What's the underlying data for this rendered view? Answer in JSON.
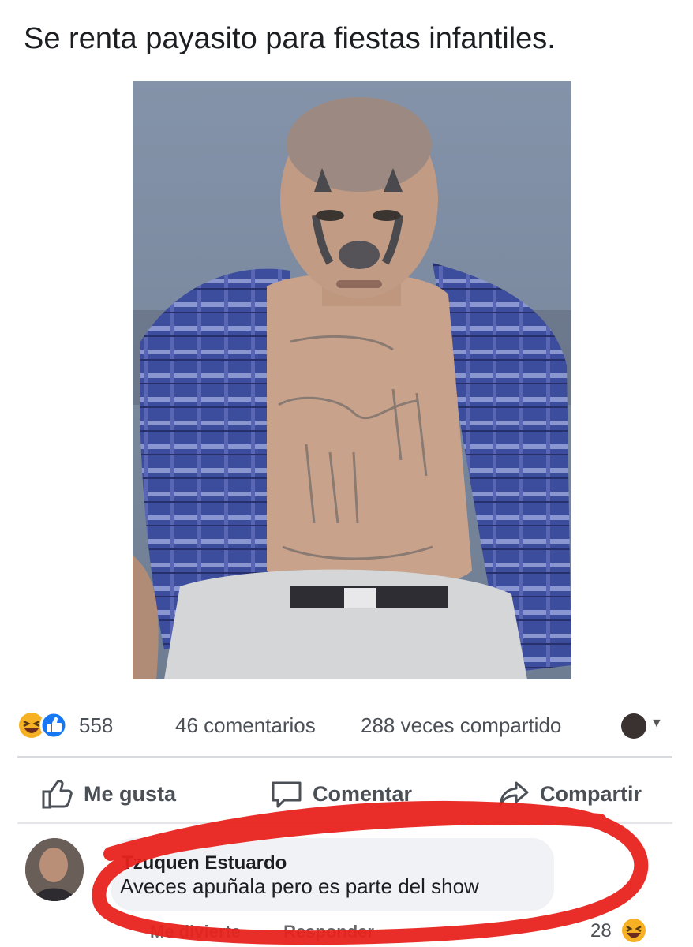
{
  "post": {
    "text": "Se renta payasito para fiestas infantiles."
  },
  "icons": {
    "haha_reaction": "laughing-face-icon",
    "like_reaction": "thumbs-up-icon",
    "like_action": "thumbs-up-outline-icon",
    "comment_action": "speech-bubble-icon",
    "share_action": "share-arrow-icon"
  },
  "stats": {
    "reactions_count": "558",
    "comments": "46 comentarios",
    "shares": "288 veces compartido"
  },
  "actions": {
    "like_label": "Me gusta",
    "comment_label": "Comentar",
    "share_label": "Compartir"
  },
  "comment": {
    "author": "Tzuquen Estuardo",
    "text": "Aveces apuñala pero es parte del show",
    "sub_like": "Me divierte",
    "sub_reply": "Responder",
    "reaction_count": "28"
  },
  "colors": {
    "like_blue": "#1877f2",
    "haha_yellow": "#f7b125",
    "annotation_red": "#e8231f",
    "wall": "#7e8ea5",
    "shirt": "#3f4fa0"
  }
}
